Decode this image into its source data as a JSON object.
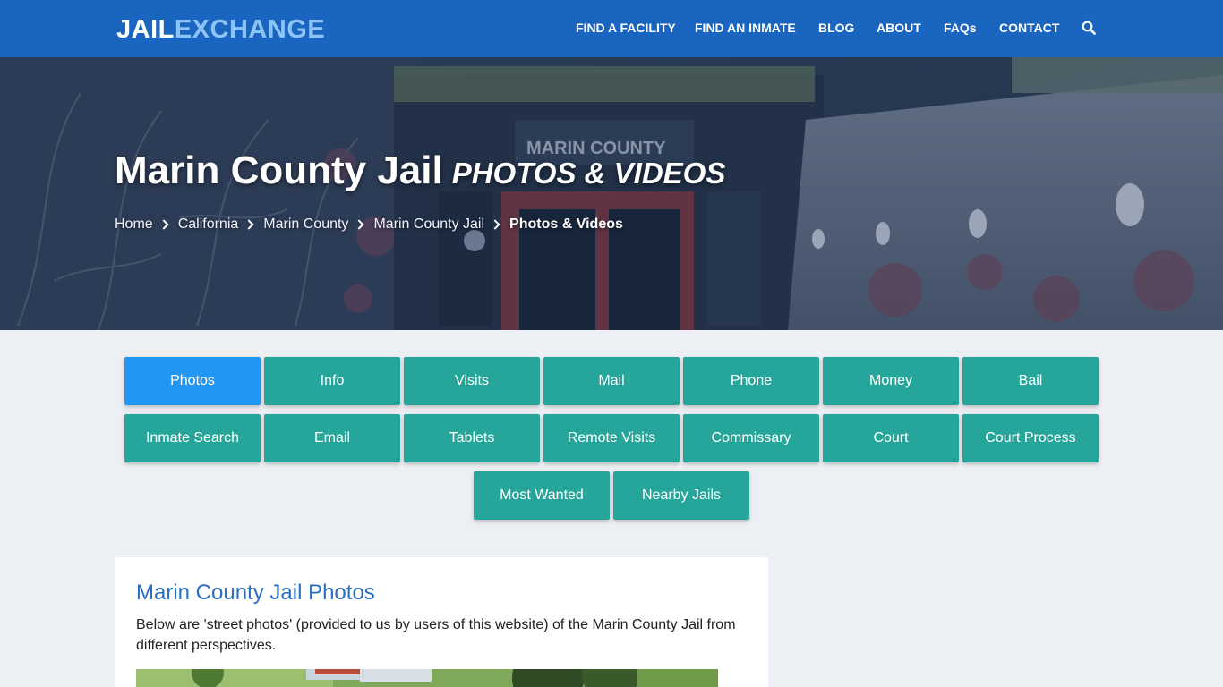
{
  "brand": {
    "part1": "JAIL",
    "part2": "EXCHANGE"
  },
  "nav": {
    "links": [
      "FIND A FACILITY",
      "FIND AN INMATE",
      "BLOG",
      "ABOUT",
      "FAQs",
      "CONTACT"
    ]
  },
  "hero": {
    "title": "Marin County Jail",
    "subtitle": "PHOTOS & VIDEOS",
    "sign_text": "MARIN COUNTY",
    "breadcrumb": [
      "Home",
      "California",
      "Marin County",
      "Marin County Jail",
      "Photos & Videos"
    ]
  },
  "tabs": {
    "row1": [
      "Photos",
      "Info",
      "Visits",
      "Mail",
      "Phone",
      "Money",
      "Bail"
    ],
    "row2": [
      "Inmate Search",
      "Email",
      "Tablets",
      "Remote Visits",
      "Commissary",
      "Court",
      "Court Process"
    ],
    "row3": [
      "Most Wanted",
      "Nearby Jails"
    ],
    "active": "Photos"
  },
  "content": {
    "heading": "Marin County Jail Photos",
    "text": "Below are 'street photos' (provided to us by users of this website) of the Marin County Jail from different perspectives."
  },
  "colors": {
    "navbar": "#1a65c0",
    "button": "#26a69a",
    "button_active": "#2196f3",
    "heading": "#2a6fc4"
  }
}
